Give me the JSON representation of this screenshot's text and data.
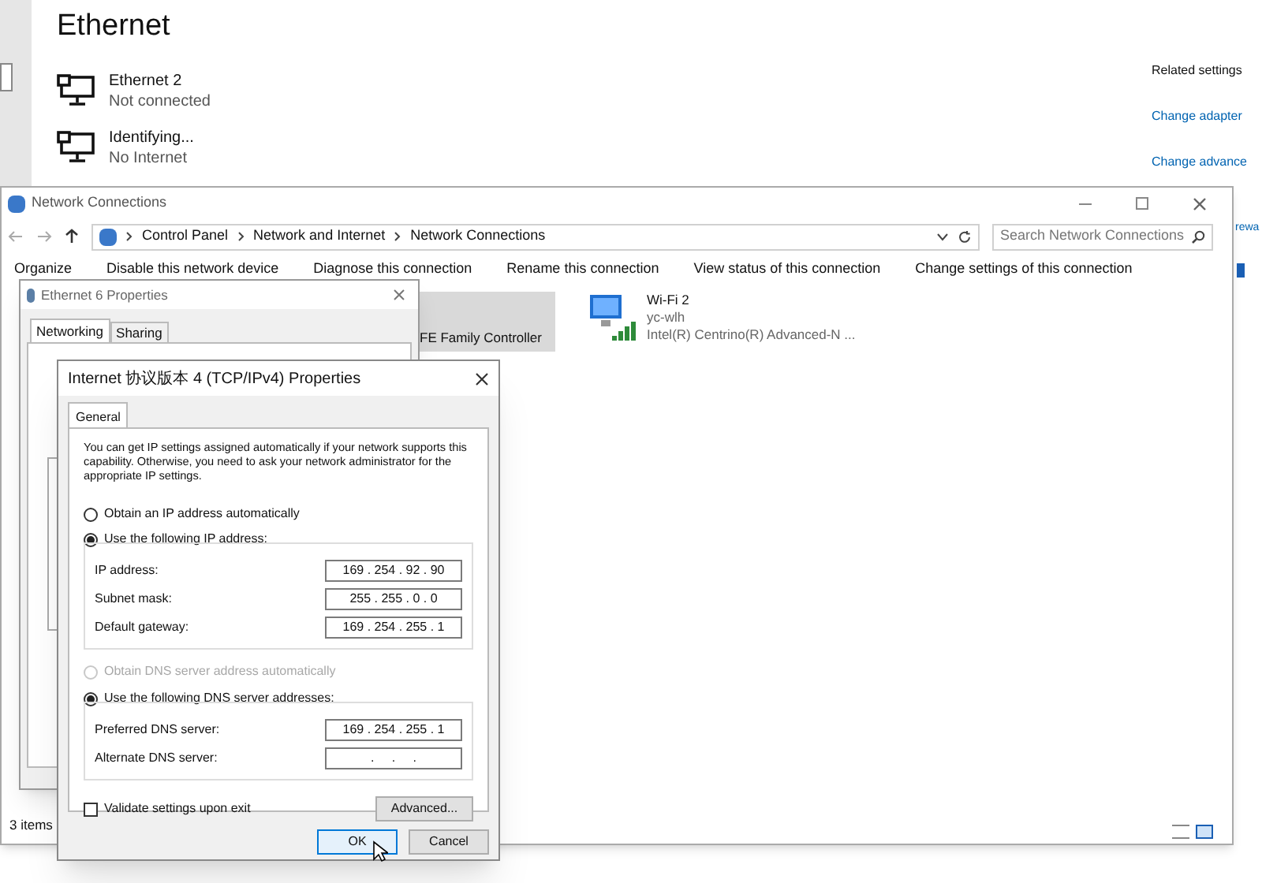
{
  "settings_page": {
    "title": "Ethernet",
    "connections": [
      {
        "name": "Ethernet 2",
        "status": "Not connected"
      },
      {
        "name": "Identifying...",
        "status": "No Internet"
      }
    ],
    "related_settings": {
      "heading": "Related settings",
      "links": [
        "Change adapter",
        "Change advance"
      ]
    },
    "link_fragment": "rewa"
  },
  "explorer": {
    "title": "Network Connections",
    "breadcrumbs": [
      "Control Panel",
      "Network and Internet",
      "Network Connections"
    ],
    "search": {
      "placeholder": "Search Network Connections"
    },
    "toolbar": [
      "Organize",
      "Disable this network device",
      "Diagnose this connection",
      "Rename this connection",
      "View status of this connection",
      "Change settings of this connection"
    ],
    "items": [
      {
        "kind": "wired",
        "selected": true,
        "lines": [
          "FE Family Controller"
        ]
      },
      {
        "kind": "wifi",
        "selected": false,
        "lines": [
          "Wi-Fi 2",
          "yc-wlh",
          "Intel(R) Centrino(R) Advanced-N ..."
        ]
      }
    ],
    "status_bar": "3 items"
  },
  "ethernet_dialog": {
    "title": "Ethernet 6 Properties",
    "tabs": [
      {
        "label": "Networking",
        "selected": true
      },
      {
        "label": "Sharing",
        "selected": false
      }
    ]
  },
  "ipv4_dialog": {
    "title": "Internet 协议版本 4 (TCP/IPv4) Properties",
    "tab": "General",
    "intro": "You can get IP settings assigned automatically if your network supports this capability. Otherwise, you need to ask your network administrator for the appropriate IP settings.",
    "ip_mode": [
      {
        "label": "Obtain an IP address automatically",
        "selected": false,
        "disabled": false
      },
      {
        "label": "Use the following IP address:",
        "selected": true,
        "disabled": false
      }
    ],
    "ip_fields": [
      {
        "label": "IP address:",
        "value": "169 . 254 . 92 . 90"
      },
      {
        "label": "Subnet mask:",
        "value": "255 . 255 . 0 . 0"
      },
      {
        "label": "Default gateway:",
        "value": "169 . 254 . 255 . 1"
      }
    ],
    "dns_mode": [
      {
        "label": "Obtain DNS server address automatically",
        "selected": false,
        "disabled": true
      },
      {
        "label": "Use the following DNS server addresses:",
        "selected": true,
        "disabled": false
      }
    ],
    "dns_fields": [
      {
        "label": "Preferred DNS server:",
        "value": "169 . 254 . 255 . 1"
      },
      {
        "label": "Alternate DNS server:",
        "value": ".     .     ."
      }
    ],
    "validate": {
      "label": "Validate settings upon exit",
      "checked": false
    },
    "buttons": {
      "advanced": "Advanced...",
      "ok": "OK",
      "cancel": "Cancel"
    }
  }
}
